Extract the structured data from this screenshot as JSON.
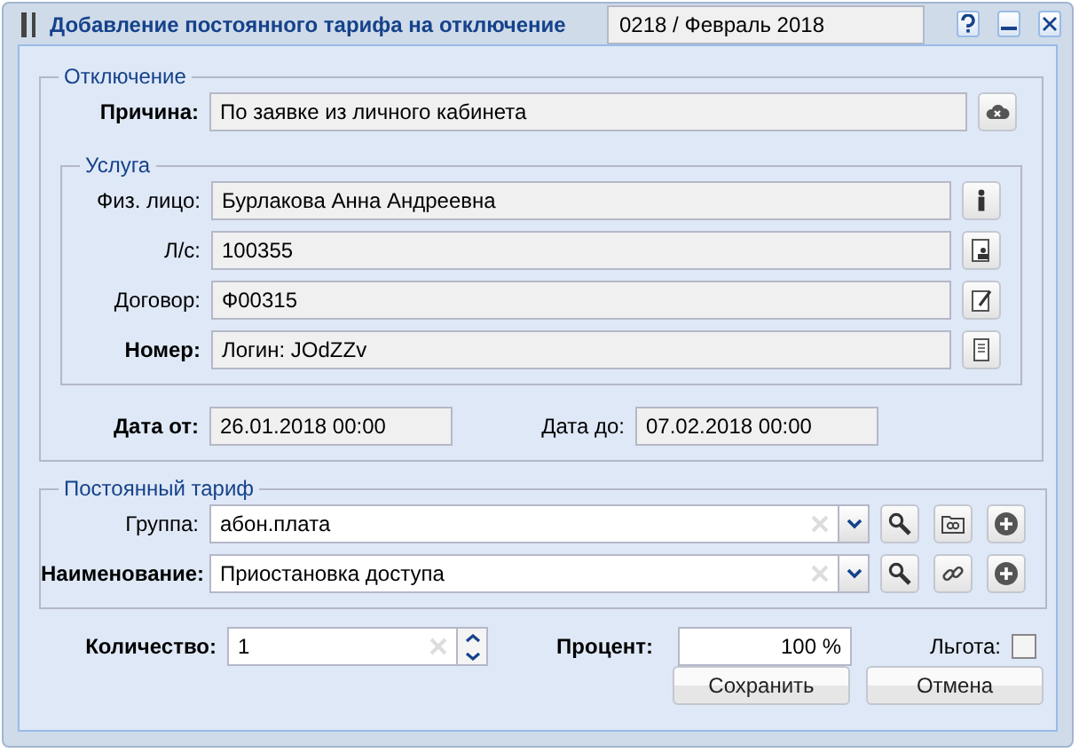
{
  "window": {
    "title": "Добавление постоянного тарифа на отключение",
    "period": "0218 / Февраль 2018"
  },
  "disconnection": {
    "legend": "Отключение",
    "reason": {
      "label": "Причина:",
      "bold": true,
      "value": "По заявке из личного кабинета"
    }
  },
  "service": {
    "legend": "Услуга",
    "fields": [
      {
        "label": "Физ. лицо:",
        "bold": false,
        "value": "Бурлакова Анна Андреевна"
      },
      {
        "label": "Л/с:",
        "bold": false,
        "value": "100355"
      },
      {
        "label": "Договор:",
        "bold": false,
        "value": "Ф00315"
      },
      {
        "label": "Номер:",
        "bold": true,
        "value": "Логин: JOdZZv"
      }
    ]
  },
  "dates": [
    {
      "label": "Дата от:",
      "bold": true,
      "value": "26.01.2018 00:00"
    },
    {
      "label": "Дата до:",
      "bold": false,
      "value": "07.02.2018 00:00"
    }
  ],
  "tariff": {
    "legend": "Постоянный тариф",
    "fields": [
      {
        "label": "Группа:",
        "bold": false,
        "value": "абон.плата"
      },
      {
        "label": "Наименование:",
        "bold": true,
        "value": "Приостановка доступа"
      }
    ]
  },
  "quantity": {
    "label": "Количество:",
    "value": "1"
  },
  "percent": {
    "label": "Процент:",
    "value": "100 %"
  },
  "benefit": {
    "label": "Льгота:",
    "checked": false
  },
  "buttons": [
    "Сохранить",
    "Отмена"
  ]
}
